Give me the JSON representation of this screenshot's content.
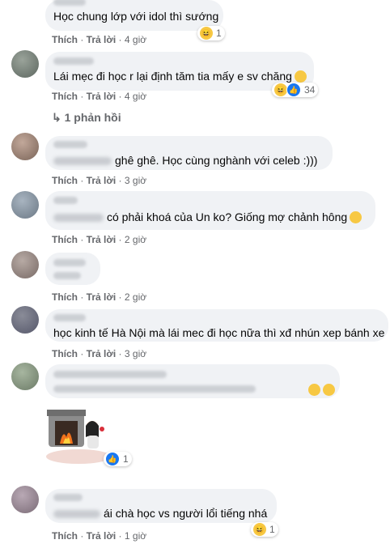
{
  "actions": {
    "like": "Thích",
    "reply": "Trả lời"
  },
  "comments": [
    {
      "text": "Học chung lớp với idol thì sướng",
      "time": "4 giờ",
      "reactions": "1"
    },
    {
      "text": "Lái mẹc đi học r lại định tăm tia mấy e sv chăng",
      "time": "4 giờ",
      "reactions": "34",
      "replies": "1 phản hồi"
    },
    {
      "text": "ghê ghê. Học cùng nghành với celeb :)))",
      "time": "3 giờ"
    },
    {
      "text": "có phải khoá của Un ko? Giống mợ chảnh hông",
      "time": "2 giờ"
    },
    {
      "text": "",
      "time": "2 giờ"
    },
    {
      "text": "học kinh tế Hà Nội mà lái mec đi học nữa thì xđ nhún xep bánh xe",
      "time": "3 giờ"
    },
    {
      "text": "",
      "time": ""
    },
    {
      "text": "",
      "time": "",
      "reactions": "1"
    },
    {
      "text": "ái chà học vs người lổi tiếng nhá",
      "time": "1 giờ",
      "reactions": "1"
    }
  ]
}
